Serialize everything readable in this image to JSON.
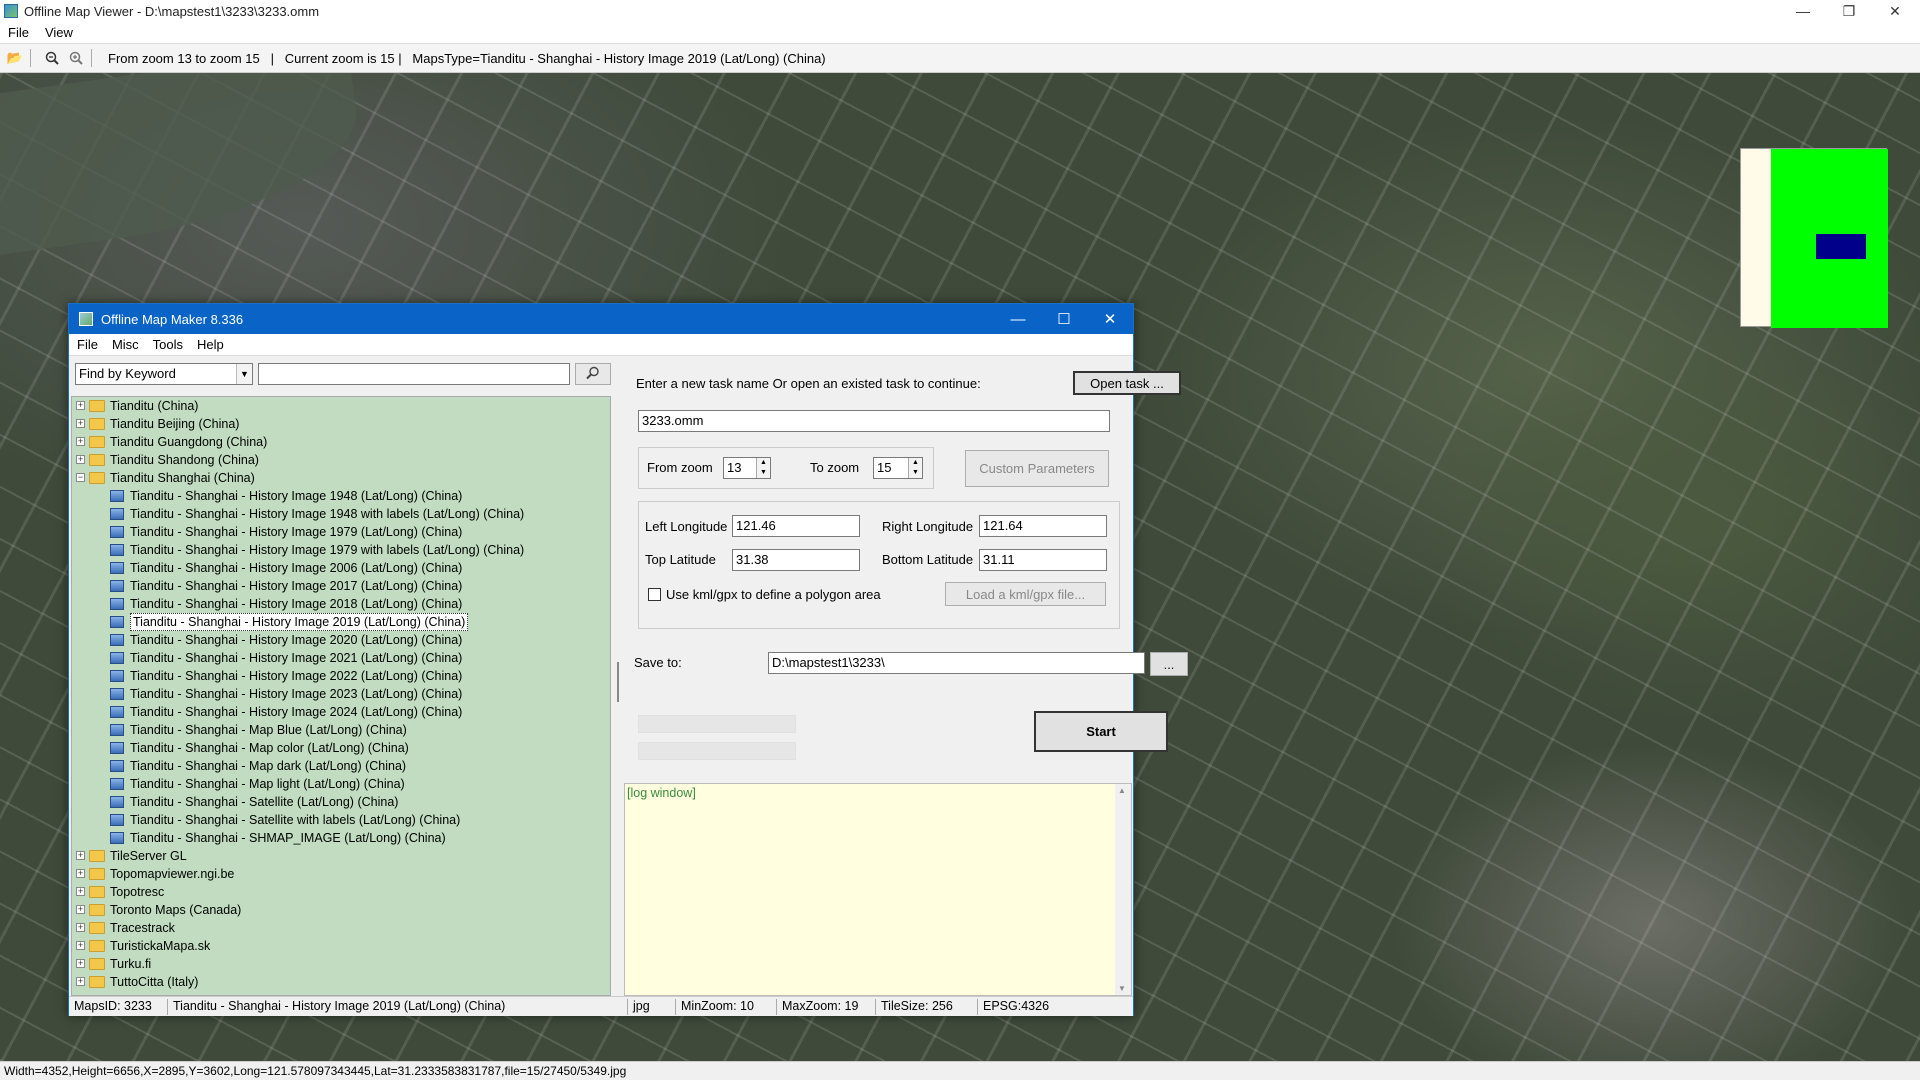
{
  "app": {
    "title": "Offline Map Viewer - D:\\mapstest1\\3233\\3233.omm",
    "menu": [
      "File",
      "View"
    ]
  },
  "toolbar": {
    "status_text": "From zoom 13 to zoom 15   |   Current zoom is 15 |   MapsType=Tianditu - Shanghai - History Image 2019 (Lat/Long) (China)"
  },
  "bottom_status": "Width=4352,Height=6656,X=2895,Y=3602,Long=121.578097343445,Lat=31.2333583831787,file=15/27450/5349.jpg",
  "dialog": {
    "title": "Offline Map Maker 8.336",
    "menu": [
      "File",
      "Misc",
      "Tools",
      "Help"
    ],
    "find": {
      "select_value": "Find by Keyword",
      "input_value": ""
    },
    "tree": [
      {
        "type": "folder",
        "label": "Tianditu (China)",
        "expanded": false,
        "level": 0
      },
      {
        "type": "folder",
        "label": "Tianditu Beijing (China)",
        "expanded": false,
        "level": 0
      },
      {
        "type": "folder",
        "label": "Tianditu Guangdong (China)",
        "expanded": false,
        "level": 0
      },
      {
        "type": "folder",
        "label": "Tianditu Shandong (China)",
        "expanded": false,
        "level": 0
      },
      {
        "type": "folder",
        "label": "Tianditu Shanghai (China)",
        "expanded": true,
        "level": 0
      },
      {
        "type": "map",
        "label": "Tianditu - Shanghai - History Image 1948 (Lat/Long) (China)",
        "level": 1
      },
      {
        "type": "map",
        "label": "Tianditu - Shanghai - History Image 1948 with labels (Lat/Long) (China)",
        "level": 1
      },
      {
        "type": "map",
        "label": "Tianditu - Shanghai - History Image 1979 (Lat/Long) (China)",
        "level": 1
      },
      {
        "type": "map",
        "label": "Tianditu - Shanghai - History Image 1979 with labels (Lat/Long) (China)",
        "level": 1
      },
      {
        "type": "map",
        "label": "Tianditu - Shanghai - History Image 2006 (Lat/Long) (China)",
        "level": 1
      },
      {
        "type": "map",
        "label": "Tianditu - Shanghai - History Image 2017 (Lat/Long) (China)",
        "level": 1
      },
      {
        "type": "map",
        "label": "Tianditu - Shanghai - History Image 2018 (Lat/Long) (China)",
        "level": 1
      },
      {
        "type": "map",
        "label": "Tianditu - Shanghai - History Image 2019 (Lat/Long) (China)",
        "level": 1,
        "selected": true
      },
      {
        "type": "map",
        "label": "Tianditu - Shanghai - History Image 2020 (Lat/Long) (China)",
        "level": 1
      },
      {
        "type": "map",
        "label": "Tianditu - Shanghai - History Image 2021 (Lat/Long) (China)",
        "level": 1
      },
      {
        "type": "map",
        "label": "Tianditu - Shanghai - History Image 2022 (Lat/Long) (China)",
        "level": 1
      },
      {
        "type": "map",
        "label": "Tianditu - Shanghai - History Image 2023 (Lat/Long) (China)",
        "level": 1
      },
      {
        "type": "map",
        "label": "Tianditu - Shanghai - History Image 2024 (Lat/Long) (China)",
        "level": 1
      },
      {
        "type": "map",
        "label": "Tianditu - Shanghai - Map Blue (Lat/Long) (China)",
        "level": 1
      },
      {
        "type": "map",
        "label": "Tianditu - Shanghai - Map color (Lat/Long) (China)",
        "level": 1
      },
      {
        "type": "map",
        "label": "Tianditu - Shanghai - Map dark (Lat/Long) (China)",
        "level": 1
      },
      {
        "type": "map",
        "label": "Tianditu - Shanghai - Map light (Lat/Long) (China)",
        "level": 1
      },
      {
        "type": "map",
        "label": "Tianditu - Shanghai - Satellite (Lat/Long) (China)",
        "level": 1
      },
      {
        "type": "map",
        "label": "Tianditu - Shanghai - Satellite with labels (Lat/Long) (China)",
        "level": 1
      },
      {
        "type": "map",
        "label": "Tianditu - Shanghai - SHMAP_IMAGE (Lat/Long) (China)",
        "level": 1
      },
      {
        "type": "folder",
        "label": "TileServer GL",
        "expanded": false,
        "level": 0
      },
      {
        "type": "folder",
        "label": "Topomapviewer.ngi.be",
        "expanded": false,
        "level": 0
      },
      {
        "type": "folder",
        "label": "Topotresc",
        "expanded": false,
        "level": 0
      },
      {
        "type": "folder",
        "label": "Toronto Maps (Canada)",
        "expanded": false,
        "level": 0
      },
      {
        "type": "folder",
        "label": "Tracestrack",
        "expanded": false,
        "level": 0
      },
      {
        "type": "folder",
        "label": "TuristickaMapa.sk",
        "expanded": false,
        "level": 0
      },
      {
        "type": "folder",
        "label": "Turku.fi",
        "expanded": false,
        "level": 0
      },
      {
        "type": "folder",
        "label": "TuttoCitta (Italy)",
        "expanded": false,
        "level": 0
      }
    ],
    "task": {
      "prompt": "Enter a new task name Or open an existed task to continue:",
      "open_button": "Open task ...",
      "name_value": "3233.omm"
    },
    "zoom": {
      "from_label": "From zoom",
      "from_value": "13",
      "to_label": "To zoom",
      "to_value": "15",
      "custom_button": "Custom Parameters"
    },
    "bounds": {
      "left_label": "Left Longitude",
      "left_value": "121.46",
      "right_label": "Right Longitude",
      "right_value": "121.64",
      "top_label": "Top Latitude",
      "top_value": "31.38",
      "bottom_label": "Bottom Latitude",
      "bottom_value": "31.11",
      "kml_label": "Use kml/gpx to define a polygon area",
      "kml_button": "Load a kml/gpx file..."
    },
    "save": {
      "label": "Save to:",
      "value": "D:\\mapstest1\\3233\\",
      "browse": "..."
    },
    "start_button": "Start",
    "log_text": "[log window]",
    "status": {
      "maps_id": "MapsID: 3233",
      "map_name": "Tianditu - Shanghai - History Image 2019 (Lat/Long) (China)",
      "format": "jpg",
      "min_zoom": "MinZoom: 10",
      "max_zoom": "MaxZoom: 19",
      "tile_size": "TileSize: 256",
      "epsg": "EPSG:4326"
    }
  }
}
